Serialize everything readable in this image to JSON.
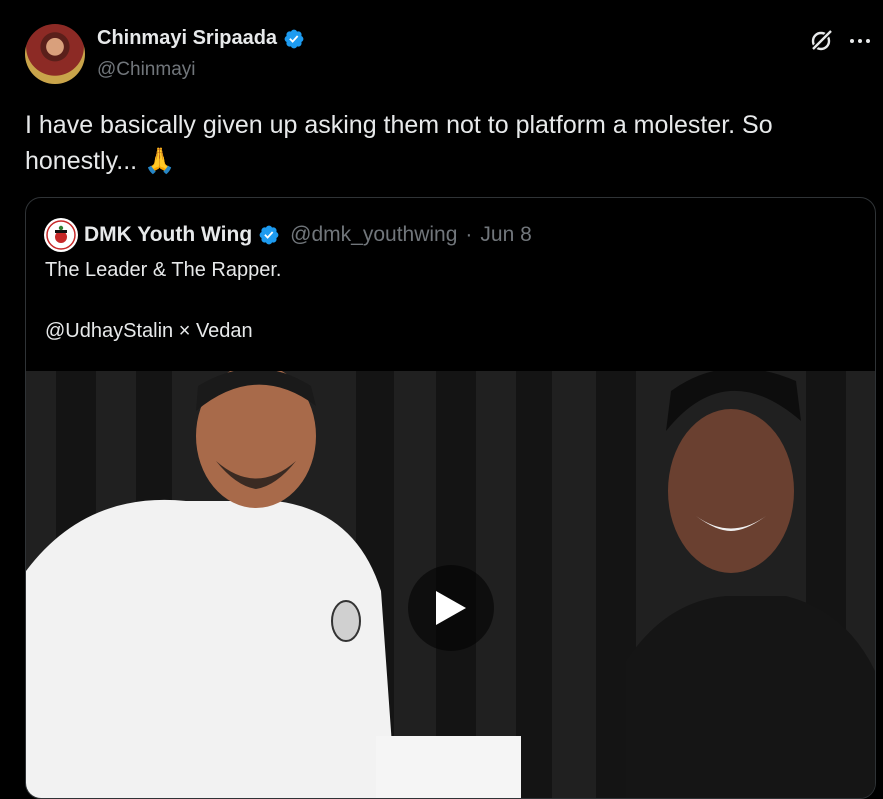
{
  "author": {
    "display_name": "Chinmayi Sripaada",
    "handle": "@Chinmayi",
    "verified": true
  },
  "tweet": {
    "text": "I have basically given up asking them not to platform a molester. So honestly... 🙏"
  },
  "quoted": {
    "display_name": "DMK Youth Wing",
    "handle": "@dmk_youthwing",
    "separator": "·",
    "date": "Jun 8",
    "line1": "The Leader & The Rapper.",
    "line2": "@UdhayStalin × Vedan"
  },
  "icons": {
    "verified": "verified-badge-icon",
    "grok": "grok-icon",
    "more": "more-options-icon",
    "play": "play-icon"
  },
  "colors": {
    "background": "#000000",
    "text_primary": "#e7e9ea",
    "text_secondary": "#71767b",
    "verified_blue": "#1d9bf0",
    "border": "#2f3336"
  }
}
